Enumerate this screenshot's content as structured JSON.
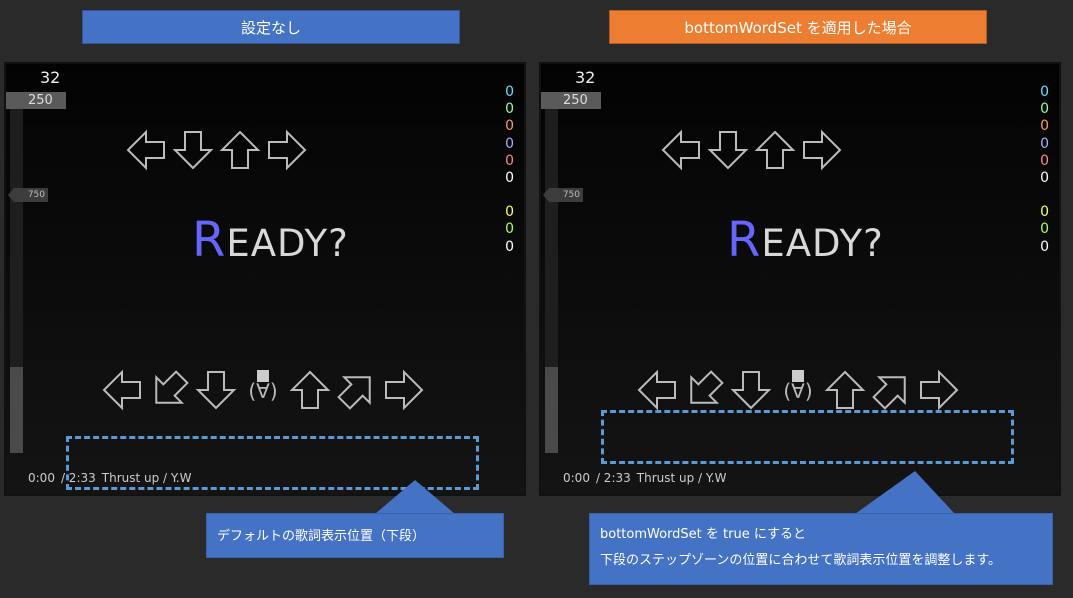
{
  "headers": {
    "left": "設定なし",
    "right": "bottomWordSet を適用した場合"
  },
  "panels": [
    {
      "combo": "32",
      "speed": "250",
      "speed_marker": "750",
      "ready_first": "R",
      "ready_rest": "EADY?",
      "judge_counts": [
        "0",
        "0",
        "0",
        "0",
        "0",
        "0",
        "0",
        "0",
        "0"
      ],
      "time_current": "0:00",
      "time_total": "/ 2:33",
      "song": "Thrust up / Y.W"
    },
    {
      "combo": "32",
      "speed": "250",
      "speed_marker": "750",
      "ready_first": "R",
      "ready_rest": "EADY?",
      "judge_counts": [
        "0",
        "0",
        "0",
        "0",
        "0",
        "0",
        "0",
        "0",
        "0"
      ],
      "time_current": "0:00",
      "time_total": "/ 2:33",
      "song": "Thrust up / Y.W"
    }
  ],
  "callouts": {
    "left": "デフォルトの歌詞表示位置（下段）",
    "right_line1": "bottomWordSet を true にすると",
    "right_line2": "下段のステップゾーンの位置に合わせて歌詞表示位置を調整します。"
  },
  "colors": {
    "judge": [
      "#66e0ff",
      "#99ff99",
      "#ff9966",
      "#aaaaff",
      "#ff8888",
      "#ffffff",
      "#ffff66",
      "#aaff66",
      "#ffffff"
    ],
    "ready_first": "#6666ff",
    "header_left": "#4472c4",
    "header_right": "#ed7d31",
    "dash": "#5b9bd5"
  },
  "icons": {
    "top_arrows": [
      "left-arrow-icon",
      "down-arrow-icon",
      "up-arrow-icon",
      "right-arrow-icon"
    ],
    "bottom_arrows": [
      "left-arrow-icon",
      "down-left-arrow-icon",
      "down-arrow-icon",
      "face-icon",
      "up-arrow-icon",
      "up-right-arrow-icon",
      "right-arrow-icon"
    ]
  }
}
